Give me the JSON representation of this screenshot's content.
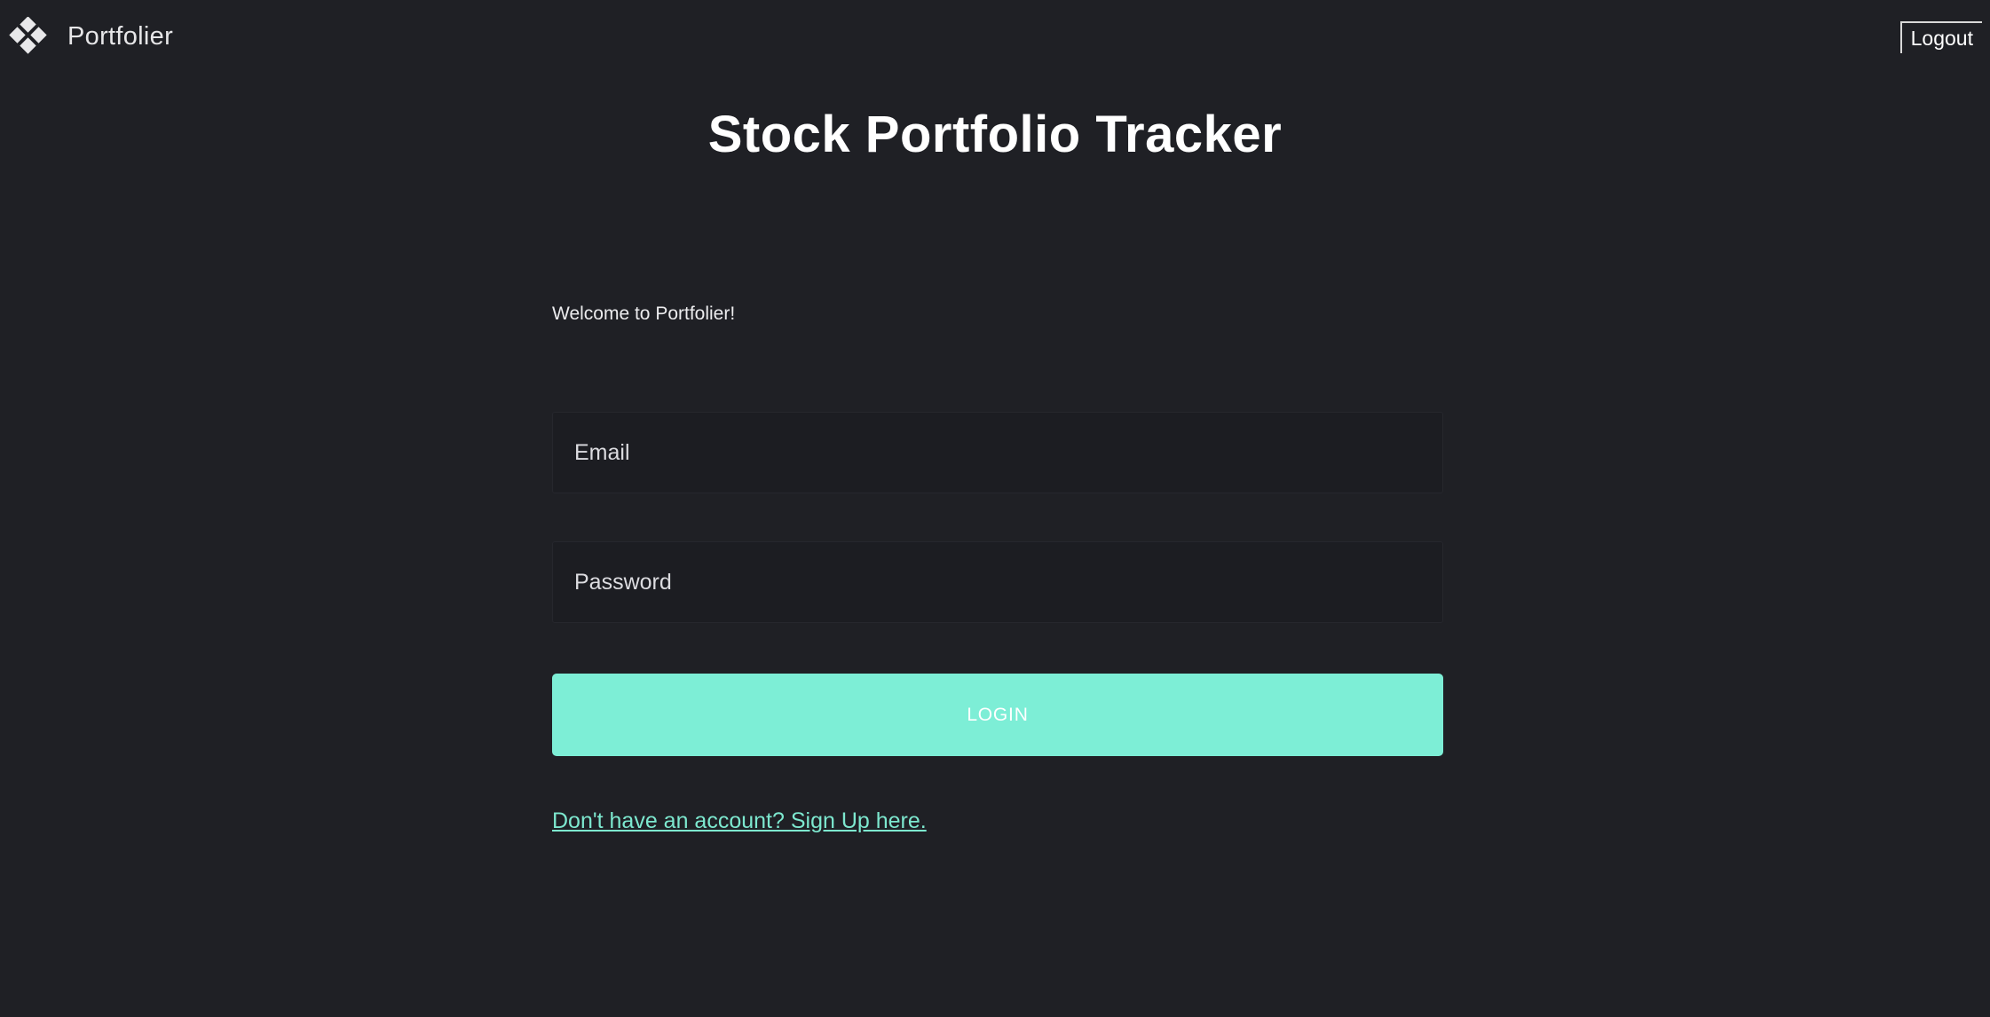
{
  "app": {
    "name": "Portfolier",
    "logo_icon": "diamond-cluster-icon"
  },
  "header": {
    "logout_label": "Logout"
  },
  "page": {
    "title": "Stock Portfolio Tracker",
    "welcome": "Welcome to Portfolier!"
  },
  "form": {
    "email_placeholder": "Email",
    "email_value": "",
    "password_placeholder": "Password",
    "password_value": "",
    "login_label": "LOGIN",
    "signup_link": "Don't have an account? Sign Up here."
  },
  "colors": {
    "background": "#1f2025",
    "accent": "#7deed6",
    "link": "#7de8cf"
  }
}
